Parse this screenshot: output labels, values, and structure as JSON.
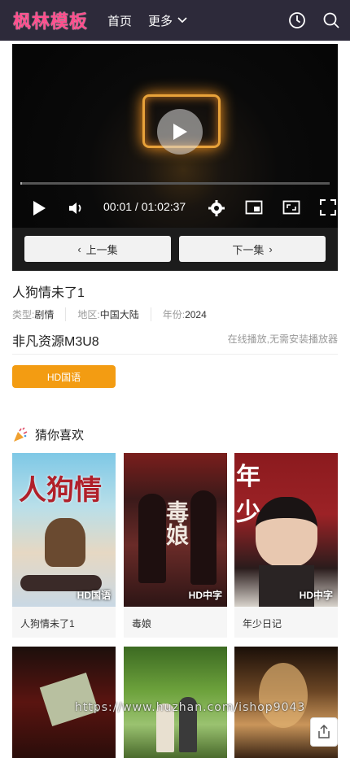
{
  "header": {
    "logo": "枫林模板",
    "nav": [
      {
        "label": "首页"
      },
      {
        "label": "更多"
      }
    ],
    "colors": {
      "bg": "#2d2a3a",
      "logo": "#ff4d8c"
    }
  },
  "player": {
    "time_current": "00:01",
    "time_total": "01:02:37",
    "time_text": "00:01 / 01:02:37",
    "progress_fraction": 0.0003,
    "prev_label": "上一集",
    "next_label": "下一集"
  },
  "video": {
    "title": "人狗情未了1",
    "meta": [
      {
        "key": "类型:",
        "value": "剧情"
      },
      {
        "key": "地区:",
        "value": "中国大陆"
      },
      {
        "key": "年份:",
        "value": "2024"
      }
    ],
    "source_name": "非凡资源M3U8",
    "source_tip": "在线播放,无需安装播放器",
    "episode_button": "HD国语",
    "accent": "#f39c12"
  },
  "recommend": {
    "title": "猜你喜欢",
    "items": [
      {
        "title": "人狗情未了1",
        "badge": "HD国语",
        "poster_text": "人狗情"
      },
      {
        "title": "毒娘",
        "badge": "HD中字",
        "poster_text": "毒娘"
      },
      {
        "title": "年少日记",
        "badge": "HD中字",
        "poster_text": "年少"
      },
      {
        "title": "",
        "badge": "",
        "poster_text": ""
      },
      {
        "title": "",
        "badge": "",
        "poster_text": ""
      },
      {
        "title": "",
        "badge": "",
        "poster_text": ""
      }
    ]
  },
  "watermark": "https://www.huzhan.com/ishop9043"
}
